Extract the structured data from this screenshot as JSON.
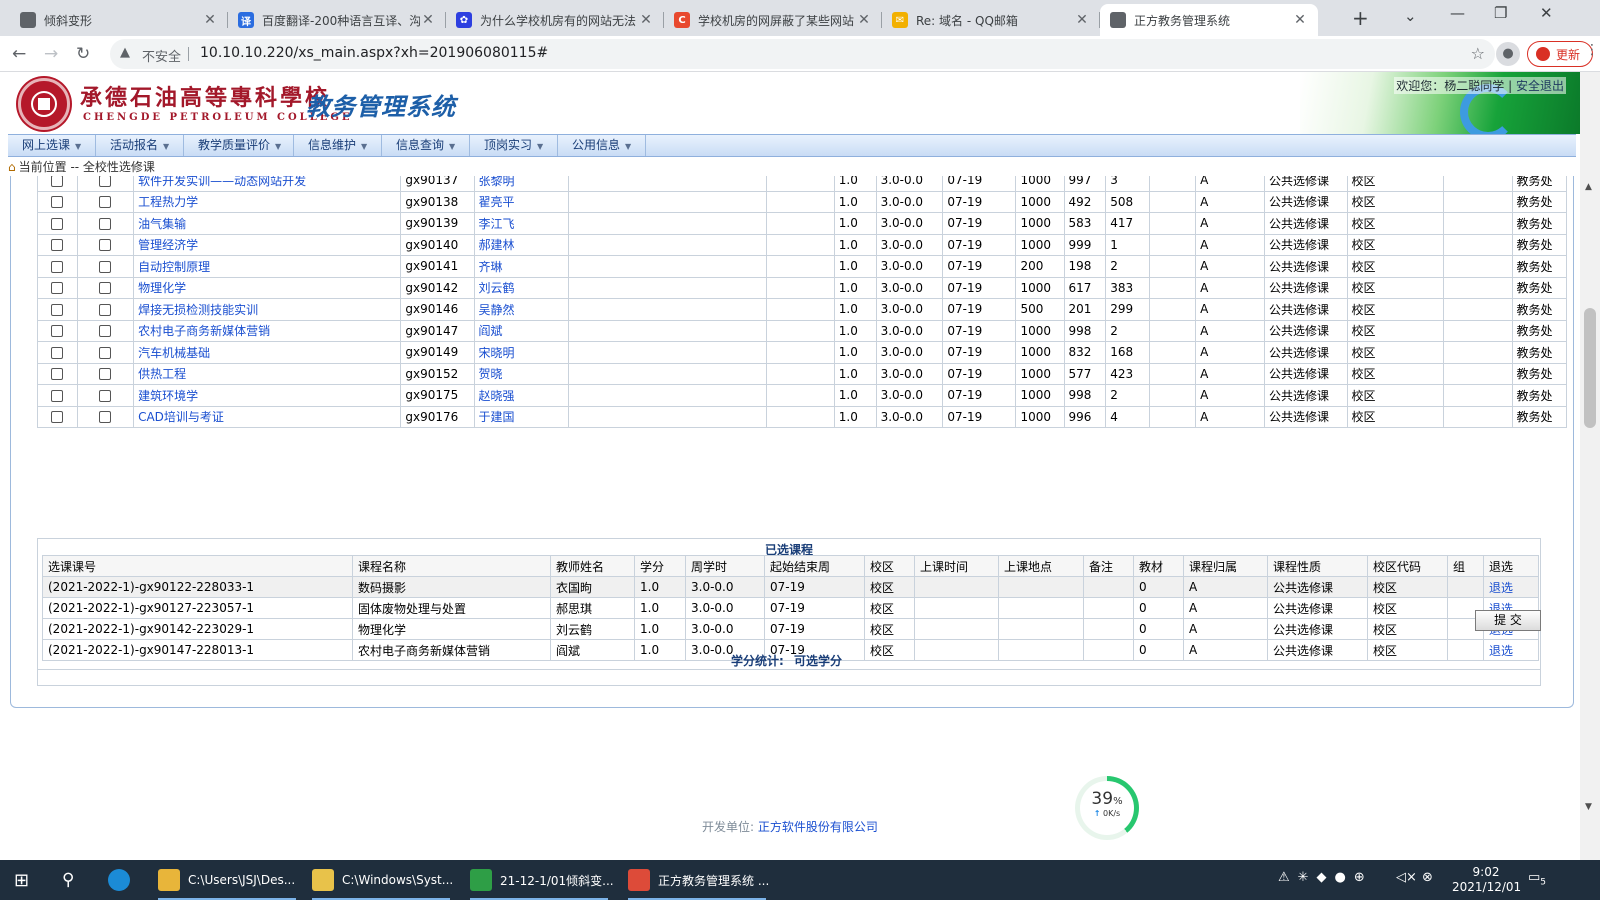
{
  "browser": {
    "tabs": [
      {
        "title": "倾斜变形",
        "icon_color": "#5f6368",
        "icon": "globe-icon",
        "icon_glyph": ""
      },
      {
        "title": "百度翻译-200种语言互译、沟",
        "icon_color": "#2b6de0",
        "icon": "baidu-translate-icon",
        "icon_glyph": "译"
      },
      {
        "title": "为什么学校机房有的网站无法",
        "icon_color": "#2d3fe0",
        "icon": "baidu-paw-icon",
        "icon_glyph": "✿"
      },
      {
        "title": "学校机房的网屏蔽了某些网站",
        "icon_color": "#e8492e",
        "icon": "csdn-icon",
        "icon_glyph": "C"
      },
      {
        "title": "Re: 域名 - QQ邮箱",
        "icon_color": "#f2b000",
        "icon": "qq-mail-icon",
        "icon_glyph": "✉"
      },
      {
        "title": "正方教务管理系统",
        "icon_color": "#5f6368",
        "icon": "globe-icon",
        "icon_glyph": "",
        "active": true
      }
    ],
    "url": "10.10.10.220/xs_main.aspx?xh=201906080115#",
    "insecure_label": "不安全",
    "update_label": "更新"
  },
  "header": {
    "school_cn": "承德石油高等專科學校",
    "school_en": "CHENGDE PETROLEUM COLLEGE",
    "system_title": "教务管理系统",
    "welcome": "欢迎您：杨二聪同学",
    "logout": "安全退出"
  },
  "menu": [
    "网上选课",
    "活动报名",
    "教学质量评价",
    "信息维护",
    "信息查询",
    "顶岗实习",
    "公用信息"
  ],
  "breadcrumb": "当前位置 -- 全校性选修课",
  "courses": [
    {
      "name": "软件开发实训——动态网站开发",
      "code": "gx90137",
      "teacher": "张黎明",
      "credit": "1.0",
      "hours": "3.0-0.0",
      "weeks": "07-19",
      "cap": "1000",
      "rem": "997",
      "sel": "3",
      "grade": "A",
      "type": "公共选修课",
      "campus": "校区",
      "dept": "教务处"
    },
    {
      "name": "工程热力学",
      "code": "gx90138",
      "teacher": "翟亮平",
      "credit": "1.0",
      "hours": "3.0-0.0",
      "weeks": "07-19",
      "cap": "1000",
      "rem": "492",
      "sel": "508",
      "grade": "A",
      "type": "公共选修课",
      "campus": "校区",
      "dept": "教务处"
    },
    {
      "name": "油气集输",
      "code": "gx90139",
      "teacher": "李江飞",
      "credit": "1.0",
      "hours": "3.0-0.0",
      "weeks": "07-19",
      "cap": "1000",
      "rem": "583",
      "sel": "417",
      "grade": "A",
      "type": "公共选修课",
      "campus": "校区",
      "dept": "教务处"
    },
    {
      "name": "管理经济学",
      "code": "gx90140",
      "teacher": "郝建林",
      "credit": "1.0",
      "hours": "3.0-0.0",
      "weeks": "07-19",
      "cap": "1000",
      "rem": "999",
      "sel": "1",
      "grade": "A",
      "type": "公共选修课",
      "campus": "校区",
      "dept": "教务处"
    },
    {
      "name": "自动控制原理",
      "code": "gx90141",
      "teacher": "齐琳",
      "credit": "1.0",
      "hours": "3.0-0.0",
      "weeks": "07-19",
      "cap": "200",
      "rem": "198",
      "sel": "2",
      "grade": "A",
      "type": "公共选修课",
      "campus": "校区",
      "dept": "教务处"
    },
    {
      "name": "物理化学",
      "code": "gx90142",
      "teacher": "刘云鹤",
      "credit": "1.0",
      "hours": "3.0-0.0",
      "weeks": "07-19",
      "cap": "1000",
      "rem": "617",
      "sel": "383",
      "grade": "A",
      "type": "公共选修课",
      "campus": "校区",
      "dept": "教务处"
    },
    {
      "name": "焊接无损检测技能实训",
      "code": "gx90146",
      "teacher": "吴静然",
      "credit": "1.0",
      "hours": "3.0-0.0",
      "weeks": "07-19",
      "cap": "500",
      "rem": "201",
      "sel": "299",
      "grade": "A",
      "type": "公共选修课",
      "campus": "校区",
      "dept": "教务处"
    },
    {
      "name": "农村电子商务新媒体营销",
      "code": "gx90147",
      "teacher": "阎斌",
      "credit": "1.0",
      "hours": "3.0-0.0",
      "weeks": "07-19",
      "cap": "1000",
      "rem": "998",
      "sel": "2",
      "grade": "A",
      "type": "公共选修课",
      "campus": "校区",
      "dept": "教务处"
    },
    {
      "name": "汽车机械基础",
      "code": "gx90149",
      "teacher": "宋晓明",
      "credit": "1.0",
      "hours": "3.0-0.0",
      "weeks": "07-19",
      "cap": "1000",
      "rem": "832",
      "sel": "168",
      "grade": "A",
      "type": "公共选修课",
      "campus": "校区",
      "dept": "教务处"
    },
    {
      "name": "供热工程",
      "code": "gx90152",
      "teacher": "贺晓",
      "credit": "1.0",
      "hours": "3.0-0.0",
      "weeks": "07-19",
      "cap": "1000",
      "rem": "577",
      "sel": "423",
      "grade": "A",
      "type": "公共选修课",
      "campus": "校区",
      "dept": "教务处"
    },
    {
      "name": "建筑环境学",
      "code": "gx90175",
      "teacher": "赵晓强",
      "credit": "1.0",
      "hours": "3.0-0.0",
      "weeks": "07-19",
      "cap": "1000",
      "rem": "998",
      "sel": "2",
      "grade": "A",
      "type": "公共选修课",
      "campus": "校区",
      "dept": "教务处"
    },
    {
      "name": "CAD培训与考证",
      "code": "gx90176",
      "teacher": "于建国",
      "credit": "1.0",
      "hours": "3.0-0.0",
      "weeks": "07-19",
      "cap": "1000",
      "rem": "996",
      "sel": "4",
      "grade": "A",
      "type": "公共选修课",
      "campus": "校区",
      "dept": "教务处"
    }
  ],
  "selected": {
    "title": "已选课程",
    "headers": [
      "选课课号",
      "课程名称",
      "教师姓名",
      "学分",
      "周学时",
      "起始结束周",
      "校区",
      "上课时间",
      "上课地点",
      "备注",
      "教材",
      "课程归属",
      "课程性质",
      "校区代码",
      "组",
      "退选"
    ],
    "rows": [
      {
        "id": "(2021-2022-1)-gx90122-228033-1",
        "name": "数码摄影",
        "teacher": "衣国昫",
        "credit": "1.0",
        "hours": "3.0-0.0",
        "weeks": "07-19",
        "campus": "校区",
        "time": "",
        "place": "",
        "note": "",
        "book": "0",
        "belong": "A",
        "nature": "公共选修课",
        "campus_code": "校区",
        "group": "",
        "drop": "退选"
      },
      {
        "id": "(2021-2022-1)-gx90127-223057-1",
        "name": "固体废物处理与处置",
        "teacher": "郝思琪",
        "credit": "1.0",
        "hours": "3.0-0.0",
        "weeks": "07-19",
        "campus": "校区",
        "time": "",
        "place": "",
        "note": "",
        "book": "0",
        "belong": "A",
        "nature": "公共选修课",
        "campus_code": "校区",
        "group": "",
        "drop": "退选"
      },
      {
        "id": "(2021-2022-1)-gx90142-223029-1",
        "name": "物理化学",
        "teacher": "刘云鹤",
        "credit": "1.0",
        "hours": "3.0-0.0",
        "weeks": "07-19",
        "campus": "校区",
        "time": "",
        "place": "",
        "note": "",
        "book": "0",
        "belong": "A",
        "nature": "公共选修课",
        "campus_code": "校区",
        "group": "",
        "drop": "退选"
      },
      {
        "id": "(2021-2022-1)-gx90147-228013-1",
        "name": "农村电子商务新媒体营销",
        "teacher": "阎斌",
        "credit": "1.0",
        "hours": "3.0-0.0",
        "weeks": "07-19",
        "campus": "校区",
        "time": "",
        "place": "",
        "note": "",
        "book": "0",
        "belong": "A",
        "nature": "公共选修课",
        "campus_code": "校区",
        "group": "",
        "drop": "退选"
      }
    ]
  },
  "credit_stats": {
    "label": "学分统计:",
    "value": "可选学分"
  },
  "submit_label": "提 交",
  "footer": {
    "label": "开发单位:",
    "company": "正方软件股份有限公司"
  },
  "speed_widget": {
    "percent": "39",
    "unit": "%",
    "rate": "0K/s"
  },
  "taskbar": {
    "apps": [
      {
        "label": "C:\\Users\\JSJ\\Des...",
        "icon": "folder-icon",
        "color": "#e8b53a"
      },
      {
        "label": "C:\\Windows\\Syst...",
        "icon": "folder-icon",
        "color": "#e8c24a"
      },
      {
        "label": "21-12-1/01倾斜变...",
        "icon": "hbuilder-icon",
        "color": "#2e9e46"
      },
      {
        "label": "正方教务管理系统 ...",
        "icon": "chrome-icon",
        "color": "#dd4b39"
      }
    ],
    "time": "9:02",
    "date": "2021/12/01",
    "notif_count": "5"
  }
}
